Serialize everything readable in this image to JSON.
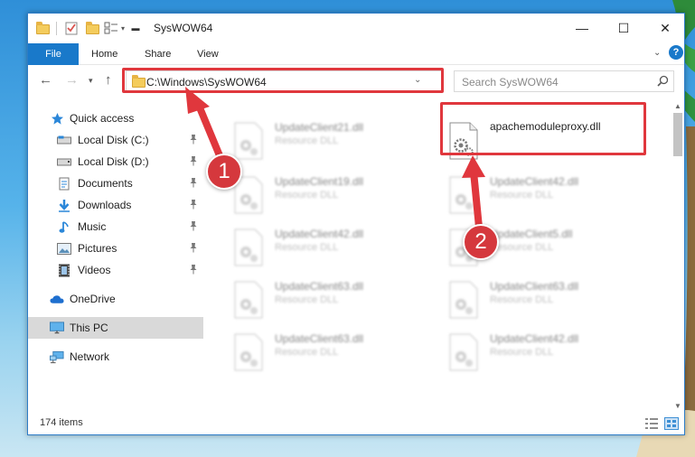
{
  "window": {
    "title": "SysWOW64",
    "controls": {
      "minimize": "—",
      "maximize": "☐",
      "close": "✕"
    }
  },
  "ribbon": {
    "file_label": "File",
    "tabs": [
      "Home",
      "Share",
      "View"
    ]
  },
  "navigation": {
    "address": "C:\\Windows\\SysWOW64",
    "search_placeholder": "Search SysWOW64"
  },
  "sidebar": {
    "items": [
      {
        "label": "Quick access",
        "icon": "star-icon"
      },
      {
        "label": "Local Disk (C:)",
        "icon": "drive-icon",
        "pinned": true
      },
      {
        "label": "Local Disk (D:)",
        "icon": "drive-icon",
        "pinned": true
      },
      {
        "label": "Documents",
        "icon": "documents-icon",
        "pinned": true
      },
      {
        "label": "Downloads",
        "icon": "download-arrow-icon",
        "pinned": true
      },
      {
        "label": "Music",
        "icon": "music-note-icon",
        "pinned": true
      },
      {
        "label": "Pictures",
        "icon": "pictures-icon",
        "pinned": true
      },
      {
        "label": "Videos",
        "icon": "film-icon",
        "pinned": true
      },
      {
        "label": "OneDrive",
        "icon": "cloud-icon"
      },
      {
        "label": "This PC",
        "icon": "monitor-icon",
        "selected": true
      },
      {
        "label": "Network",
        "icon": "network-icon"
      }
    ]
  },
  "files": {
    "left_column": [
      {
        "name": "UpdateClient21.dll",
        "type": "Resource DLL"
      },
      {
        "name": "UpdateClient19.dll",
        "type": "Resource DLL"
      },
      {
        "name": "UpdateClient42.dll",
        "type": "Resource DLL"
      },
      {
        "name": "UpdateClient63.dll",
        "type": "Resource DLL"
      },
      {
        "name": "UpdateClient63.dll",
        "type": "Resource DLL"
      }
    ],
    "right_column": [
      {
        "name": "apachemoduleproxy.dll",
        "type": ""
      },
      {
        "name": "UpdateClient42.dll",
        "type": "Resource DLL"
      },
      {
        "name": "UpdateClient5.dll",
        "type": "Resource DLL"
      },
      {
        "name": "UpdateClient63.dll",
        "type": "Resource DLL"
      },
      {
        "name": "UpdateClient42.dll",
        "type": "Resource DLL"
      }
    ]
  },
  "status": {
    "item_count": "174 items"
  },
  "annotations": {
    "step1": "1",
    "step2": "2",
    "color": "#e0373d"
  }
}
